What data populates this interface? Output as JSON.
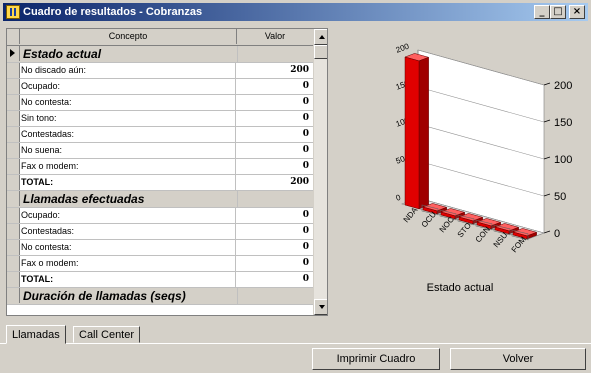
{
  "window": {
    "title": "Cuadro de resultados - Cobranzas",
    "min_label": "_",
    "max_label": "□",
    "close_label": "×"
  },
  "grid": {
    "headers": {
      "concept": "Concepto",
      "value": "Valor"
    },
    "rows": [
      {
        "type": "section",
        "concept": "Estado actual",
        "value": ""
      },
      {
        "type": "data",
        "concept": "No discado aún:",
        "value": "200"
      },
      {
        "type": "data",
        "concept": "Ocupado:",
        "value": "0"
      },
      {
        "type": "data",
        "concept": "No contesta:",
        "value": "0"
      },
      {
        "type": "data",
        "concept": "Sin tono:",
        "value": "0"
      },
      {
        "type": "data",
        "concept": "Contestadas:",
        "value": "0"
      },
      {
        "type": "data",
        "concept": "No suena:",
        "value": "0"
      },
      {
        "type": "data",
        "concept": "Fax o modem:",
        "value": "0"
      },
      {
        "type": "total",
        "concept": "TOTAL:",
        "value": "200"
      },
      {
        "type": "section",
        "concept": "Llamadas efectuadas",
        "value": ""
      },
      {
        "type": "data",
        "concept": "Ocupado:",
        "value": "0"
      },
      {
        "type": "data",
        "concept": "Contestadas:",
        "value": "0"
      },
      {
        "type": "data",
        "concept": "No contesta:",
        "value": "0"
      },
      {
        "type": "data",
        "concept": "Fax o modem:",
        "value": "0"
      },
      {
        "type": "total",
        "concept": "TOTAL:",
        "value": "0"
      },
      {
        "type": "section",
        "concept": "Duración de llamadas (seqs)",
        "value": ""
      }
    ]
  },
  "chart_data": {
    "type": "bar",
    "title": "Estado actual",
    "categories": [
      "NDA",
      "OCU",
      "NOC",
      "STO",
      "CON",
      "NSU",
      "FOM"
    ],
    "values": [
      200,
      0,
      0,
      0,
      0,
      0,
      0
    ],
    "ylim": [
      0,
      200
    ],
    "left_ticks": [
      "0",
      "50",
      "100",
      "150",
      "200"
    ],
    "right_ticks": [
      "0",
      "50",
      "100",
      "150",
      "200"
    ],
    "bar_color": "#e00000",
    "grid": true
  },
  "tabs": [
    {
      "label": "Llamadas",
      "active": true
    },
    {
      "label": "Call Center",
      "active": false
    }
  ],
  "buttons": {
    "print": "Imprimir Cuadro",
    "back": "Volver"
  }
}
